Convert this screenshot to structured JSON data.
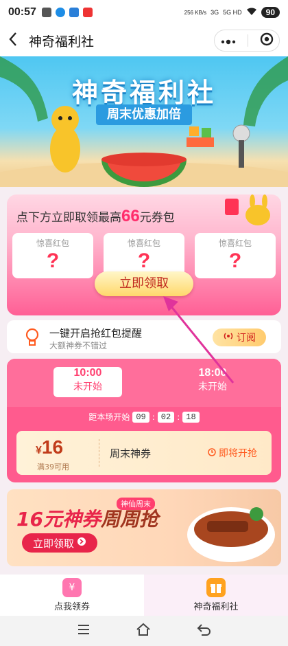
{
  "status": {
    "time": "00:57",
    "net_speed": "256\nKB/s",
    "signal1": "3G",
    "signal2": "5G HD",
    "battery": "90"
  },
  "nav": {
    "title": "神奇福利社"
  },
  "hero": {
    "title": "神奇福利社",
    "subtitle": "周末优惠加倍"
  },
  "panel": {
    "prefix": "点下方立即取领最高",
    "amount": "66",
    "suffix": "元券包",
    "cards": [
      {
        "label": "惊喜红包",
        "mark": "?"
      },
      {
        "label": "惊喜红包",
        "mark": "?"
      },
      {
        "label": "惊喜红包",
        "mark": "?"
      }
    ],
    "claim_label": "立即领取"
  },
  "reminder": {
    "title": "一键开启抢红包提醒",
    "subtitle": "大额神券不错过",
    "button": "订阅"
  },
  "session": {
    "slots": [
      {
        "time": "10:00",
        "status": "未开始"
      },
      {
        "time": "18:00",
        "status": "未开始"
      }
    ],
    "countdown_label": "距本场开始",
    "countdown": [
      "09",
      "02",
      "18"
    ],
    "coupon": {
      "currency": "¥",
      "amount": "16",
      "condition": "满39可用",
      "name": "周末神券",
      "action": "即将开抢"
    }
  },
  "banner": {
    "title": "16元神券周周抢",
    "tag": "神仙周末",
    "button": "立即领取"
  },
  "tabs": [
    {
      "label": "点我领券",
      "icon": "¥"
    },
    {
      "label": "神奇福利社",
      "icon": "gift"
    }
  ],
  "colors": {
    "accent": "#ff5b8e",
    "price": "#c13c1a",
    "claim_text": "#c0281e"
  }
}
